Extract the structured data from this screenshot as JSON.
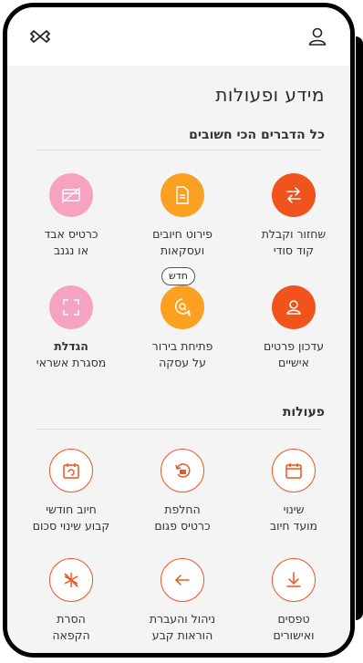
{
  "header": {
    "logo_icon": "app-logo-icon",
    "profile_icon": "user-icon"
  },
  "page": {
    "title": "מידע ופעולות"
  },
  "sections": {
    "info_title": "כל הדברים הכי חשובים",
    "actions_title": "פעולות"
  },
  "info_tiles": [
    {
      "label": "שחזור וקבלת\nקוד סודי",
      "icon": "swap-arrows-icon"
    },
    {
      "label": "פירוט חיובים\nועסקאות",
      "icon": "document-icon"
    },
    {
      "label": "כרטיס אבד\nאו נגנב",
      "icon": "blocked-card-icon"
    },
    {
      "label": "עדכון פרטים\nאישיים",
      "icon": "person-icon"
    },
    {
      "label": "פתיחת בירור\nעל עסקה",
      "icon": "search-bubble-icon",
      "badge": "חדש"
    },
    {
      "label_bold": "הגדלת",
      "label_rest": "מסגרת אשראי",
      "icon": "expand-icon"
    }
  ],
  "action_tiles": [
    {
      "label": "שינוי\nמועד חיוב",
      "icon": "calendar-icon"
    },
    {
      "label": "החלפת\nכרטיס פגום",
      "icon": "card-replace-icon"
    },
    {
      "label": "חיוב חודשי\nקבוע שינוי סכום",
      "icon": "calendar-refresh-icon"
    },
    {
      "label": "טפסים\nואישורים",
      "icon": "download-icon"
    },
    {
      "label": "ניהול והעברת\nהוראות קבע",
      "icon": "arrow-left-icon"
    },
    {
      "label": "הסרת\nהקפאה",
      "icon": "snowflake-off-icon"
    }
  ],
  "colors": {
    "accent_red": "#f0531c",
    "accent_orange": "#fca021",
    "accent_pink": "#f6a3c2"
  }
}
